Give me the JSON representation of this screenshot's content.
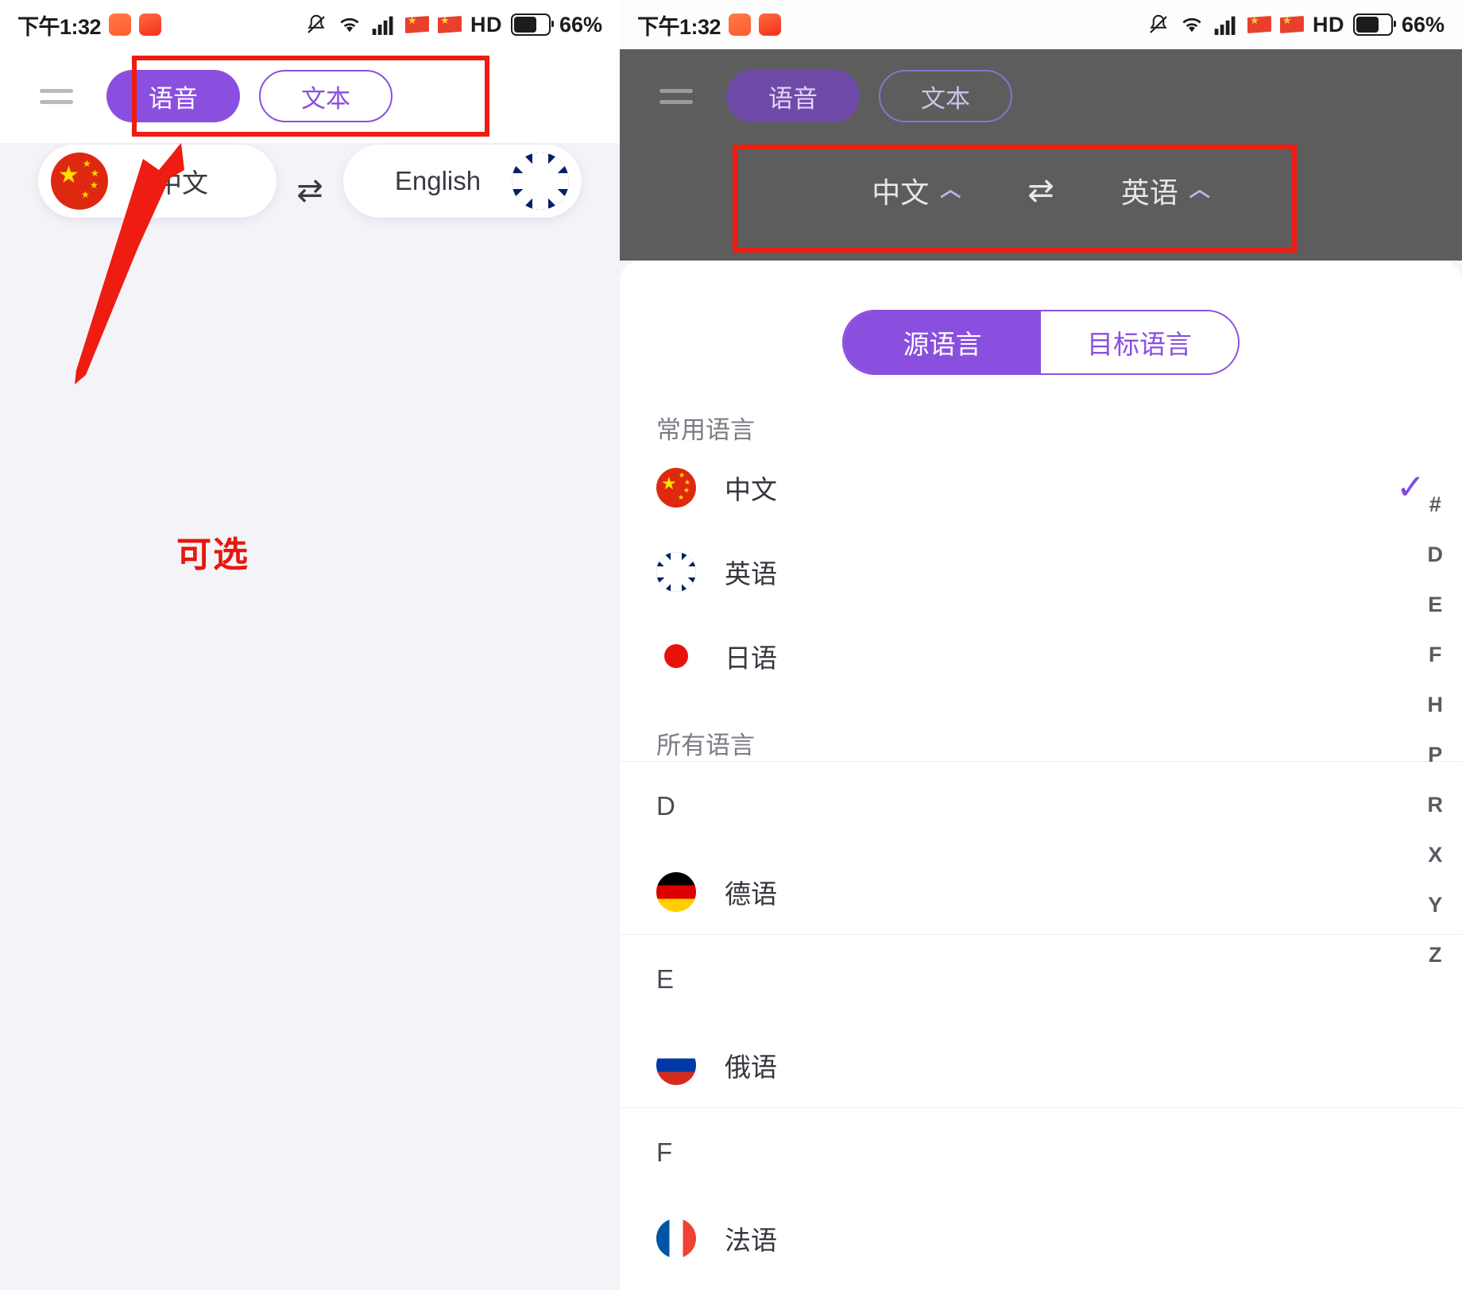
{
  "status_bar": {
    "time": "下午1:32",
    "hd_label": "HD",
    "battery_pct": "66%",
    "icons": [
      "silent-bell-icon",
      "wifi-icon",
      "signal-icon",
      "flag-icon",
      "flag-icon",
      "hd-label",
      "battery-icon"
    ]
  },
  "left_screen": {
    "menu_icon": "hamburger-menu-icon",
    "mode_tabs": [
      {
        "label": "语音",
        "state": "active"
      },
      {
        "label": "文本",
        "state": "inactive"
      }
    ],
    "language_bar": {
      "source": "中文",
      "target": "英语",
      "swap_icon": "swap-arrows-icon",
      "caret_icon": "chevron-up-icon"
    },
    "annotation": "可选",
    "bottom_buttons": [
      {
        "label": "中文",
        "flag": "china-flag-icon",
        "position": "left"
      },
      {
        "label": "English",
        "flag": "uk-flag-icon",
        "position": "right"
      }
    ]
  },
  "right_screen": {
    "menu_icon": "hamburger-menu-icon",
    "mode_tabs": [
      {
        "label": "语音",
        "state": "active"
      },
      {
        "label": "文本",
        "state": "inactive"
      }
    ],
    "language_bar": {
      "source": "中文",
      "target": "英语",
      "swap_icon": "swap-arrows-icon",
      "caret_icon": "chevron-up-icon"
    },
    "sheet": {
      "tabs": [
        {
          "label": "源语言",
          "state": "on"
        },
        {
          "label": "目标语言",
          "state": "off"
        }
      ],
      "common_header": "常用语言",
      "common_languages": [
        {
          "label": "中文",
          "flag": "china-flag-icon",
          "selected": true,
          "check_icon": "check-icon"
        },
        {
          "label": "英语",
          "flag": "uk-flag-icon",
          "selected": false
        },
        {
          "label": "日语",
          "flag": "japan-flag-icon",
          "selected": false
        }
      ],
      "all_header": "所有语言",
      "sections": [
        {
          "letter": "D",
          "languages": [
            {
              "label": "德语",
              "flag": "germany-flag-icon"
            }
          ]
        },
        {
          "letter": "E",
          "languages": [
            {
              "label": "俄语",
              "flag": "russia-flag-icon"
            }
          ]
        },
        {
          "letter": "F",
          "languages": [
            {
              "label": "法语",
              "flag": "france-flag-icon"
            }
          ]
        }
      ],
      "index_letters": [
        "#",
        "D",
        "E",
        "F",
        "H",
        "P",
        "R",
        "X",
        "Y",
        "Z"
      ]
    }
  },
  "colors": {
    "accent_purple": "#8b4fe0",
    "annotation_red": "#ee1c11",
    "page_bg": "#f4f4f8"
  }
}
